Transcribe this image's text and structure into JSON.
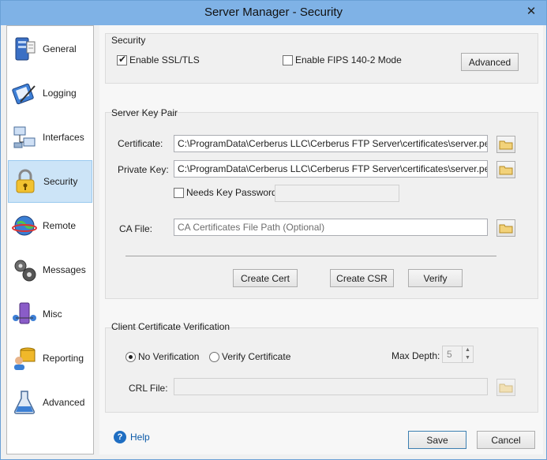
{
  "window": {
    "title": "Server Manager - Security",
    "close_symbol": "✕"
  },
  "sidebar": {
    "items": [
      {
        "label": "General",
        "icon": "server-icon"
      },
      {
        "label": "Logging",
        "icon": "notebook-pen-icon"
      },
      {
        "label": "Interfaces",
        "icon": "network-icon"
      },
      {
        "label": "Security",
        "icon": "padlock-icon",
        "active": true
      },
      {
        "label": "Remote",
        "icon": "globe-remote-icon"
      },
      {
        "label": "Messages",
        "icon": "gears-icon"
      },
      {
        "label": "Misc",
        "icon": "misc-network-icon"
      },
      {
        "label": "Reporting",
        "icon": "users-database-icon"
      },
      {
        "label": "Advanced",
        "icon": "flask-icon"
      }
    ]
  },
  "security": {
    "title": "Security",
    "enable_ssl_label": "Enable SSL/TLS",
    "enable_ssl_checked": true,
    "enable_fips_label": "Enable FIPS 140-2 Mode",
    "enable_fips_checked": false,
    "advanced_button": "Advanced"
  },
  "key_pair": {
    "title": "Server Key Pair",
    "certificate_label": "Certificate:",
    "certificate_value": "C:\\ProgramData\\Cerberus LLC\\Cerberus FTP Server\\certificates\\server.pem",
    "private_key_label": "Private Key:",
    "private_key_value": "C:\\ProgramData\\Cerberus LLC\\Cerberus FTP Server\\certificates\\server.pem",
    "needs_password_label": "Needs Key Password",
    "needs_password_checked": false,
    "ca_file_label": "CA File:",
    "ca_file_placeholder": "CA Certificates File Path (Optional)",
    "create_cert_button": "Create Cert",
    "create_csr_button": "Create CSR",
    "verify_button": "Verify"
  },
  "client_verification": {
    "title": "Client Certificate Verification",
    "no_verification_label": "No Verification",
    "verify_certificate_label": "Verify Certificate",
    "selected": "No Verification",
    "max_depth_label": "Max Depth:",
    "max_depth_value": "5",
    "crl_file_label": "CRL File:"
  },
  "footer": {
    "help_label": "Help",
    "save_button": "Save",
    "cancel_button": "Cancel"
  },
  "colors": {
    "titlebar": "#7fb2e6",
    "active_nav": "#cce4f7",
    "link": "#0b5aa8"
  }
}
